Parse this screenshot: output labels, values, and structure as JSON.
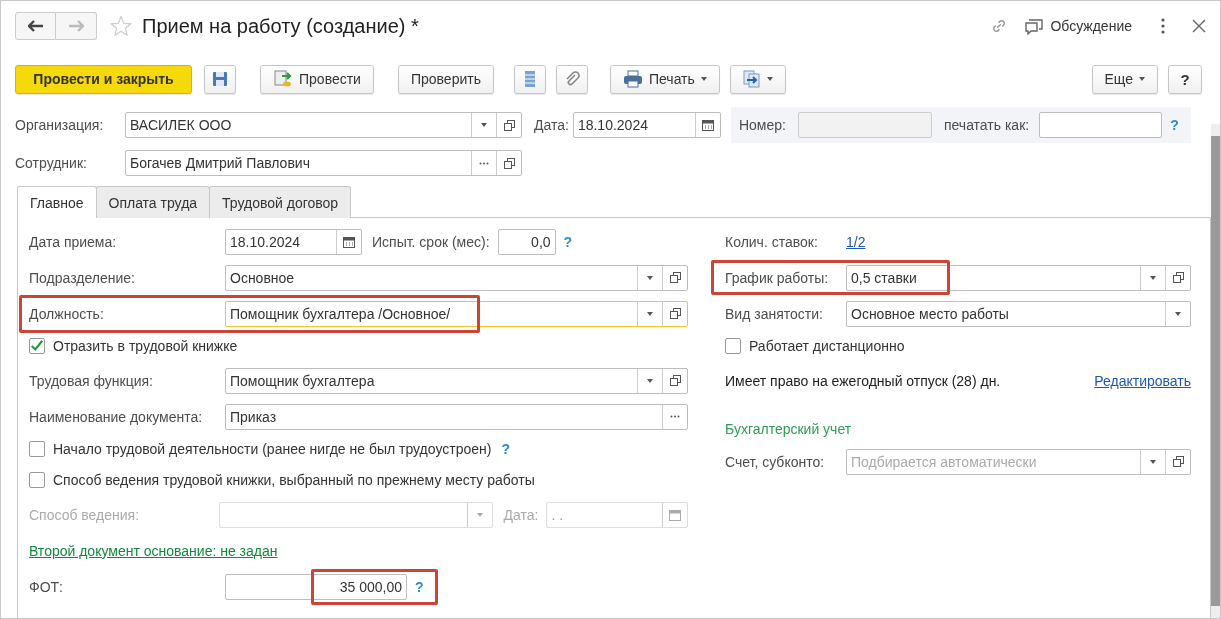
{
  "window": {
    "title": "Прием на работу (создание) *",
    "discussion": "Обсуждение"
  },
  "toolbar": {
    "post_and_close": "Провести и закрыть",
    "post": "Провести",
    "check": "Проверить",
    "print": "Печать",
    "more": "Еще",
    "help": "?"
  },
  "header": {
    "organization": {
      "label": "Организация:",
      "value": "ВАСИЛЕК ООО"
    },
    "date": {
      "label": "Дата:",
      "value": "18.10.2024"
    },
    "number": {
      "label": "Номер:",
      "disabled": true
    },
    "print_as": {
      "label": "печатать как:",
      "help": "?"
    },
    "employee": {
      "label": "Сотрудник:",
      "value": "Богачев Дмитрий Павлович"
    }
  },
  "tabs": [
    {
      "label": "Главное",
      "selected": true
    },
    {
      "label": "Оплата труда",
      "selected": false
    },
    {
      "label": "Трудовой договор",
      "selected": false
    }
  ],
  "main": {
    "hire_date": {
      "label": "Дата приема:",
      "value": "18.10.2024"
    },
    "probation": {
      "label": "Испыт. срок (мес):",
      "value": "0,0",
      "help": "?"
    },
    "department": {
      "label": "Подразделение:",
      "value": "Основное"
    },
    "position": {
      "label": "Должность:",
      "value": "Помощник бухгалтера /Основное/",
      "focused": true,
      "highlighted": true
    },
    "reflect_in_workbook": {
      "label": "Отразить в трудовой книжке",
      "checked": true
    },
    "labor_function": {
      "label": "Трудовая функция:",
      "value": "Помощник бухгалтера"
    },
    "document_name": {
      "label": "Наименование документа:",
      "value": "Приказ"
    },
    "first_employment": {
      "label": "Начало трудовой деятельности (ранее нигде не был трудоустроен)",
      "checked": false,
      "help": "?"
    },
    "keep_method": {
      "label": "Способ ведения трудовой книжки, выбранный по прежнему месту работы",
      "checked": false
    },
    "method": {
      "label": "Способ ведения:",
      "disabled": true
    },
    "method_date": {
      "label": "Дата:",
      "placeholder": ". .",
      "disabled": true
    },
    "second_document_link": "Второй документ основание: не задан",
    "payroll": {
      "label": "ФОТ:",
      "value": "35 000,00",
      "help": "?",
      "highlighted": true
    }
  },
  "right": {
    "rates": {
      "label": "Колич. ставок:",
      "value": "1/2"
    },
    "schedule": {
      "label": "График работы:",
      "value": "0,5 ставки",
      "highlighted": true
    },
    "employment_type": {
      "label": "Вид занятости:",
      "value": "Основное место работы"
    },
    "remote": {
      "label": "Работает дистанционно",
      "checked": false
    },
    "vacation_note": "Имеет право на ежегодный отпуск (28) дн.",
    "edit_link": "Редактировать",
    "accounting_heading": "Бухгалтерский учет",
    "account": {
      "label": "Счет, субконто:",
      "placeholder": "Подбирается автоматически"
    }
  }
}
